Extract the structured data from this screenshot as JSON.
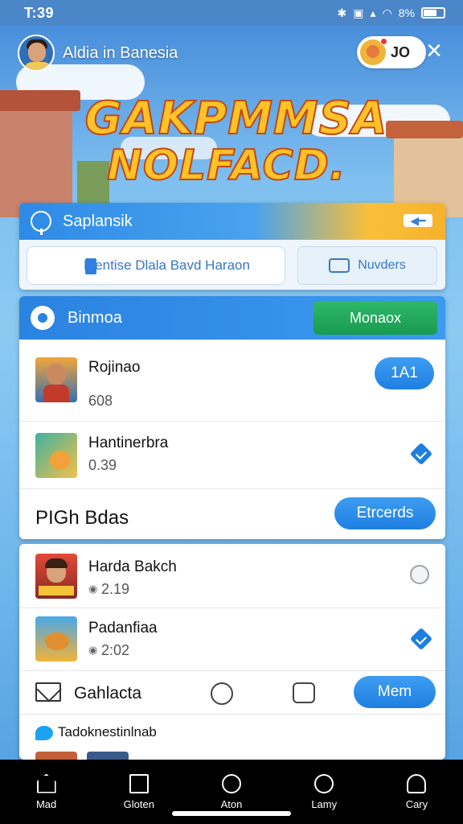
{
  "status_bar": {
    "time": "T:39",
    "battery_text": "8%"
  },
  "profile": {
    "name": "Aldia in Banesia",
    "coins": "JO"
  },
  "headline": {
    "line1": "GAKPMMSA",
    "line2": "NOLFACD."
  },
  "search": {
    "title": "Saplansik",
    "field_text": "Mentise Dlala Bavd Haraon",
    "button_label": "Nuvders"
  },
  "section1": {
    "title": "Binmoa",
    "action_label": "Monaox",
    "items": [
      {
        "title": "Rojinao",
        "sub": "608",
        "button": "1A1"
      },
      {
        "title": "Hantinerbra",
        "sub": "0.39"
      }
    ]
  },
  "section2": {
    "title": "PIGh Bdas",
    "button": "Etrcerds"
  },
  "section3": {
    "items": [
      {
        "title": "Harda Bakch",
        "sub": "2.19"
      },
      {
        "title": "Padanfiaa",
        "sub": "2:02"
      }
    ],
    "tool_label": "Gahlacta",
    "tool_button": "Mem",
    "footer_label": "Tadoknestinlnab"
  },
  "bottom_nav": [
    {
      "label": "Mad",
      "icon": "home-icon"
    },
    {
      "label": "Gloten",
      "icon": "document-icon"
    },
    {
      "label": "Aton",
      "icon": "circle-icon"
    },
    {
      "label": "Lamy",
      "icon": "smile-icon"
    },
    {
      "label": "Cary",
      "icon": "user-icon"
    }
  ],
  "colors": {
    "accent_blue": "#1f7fe0",
    "accent_green": "#179a50",
    "headline_yellow": "#ffc228"
  }
}
